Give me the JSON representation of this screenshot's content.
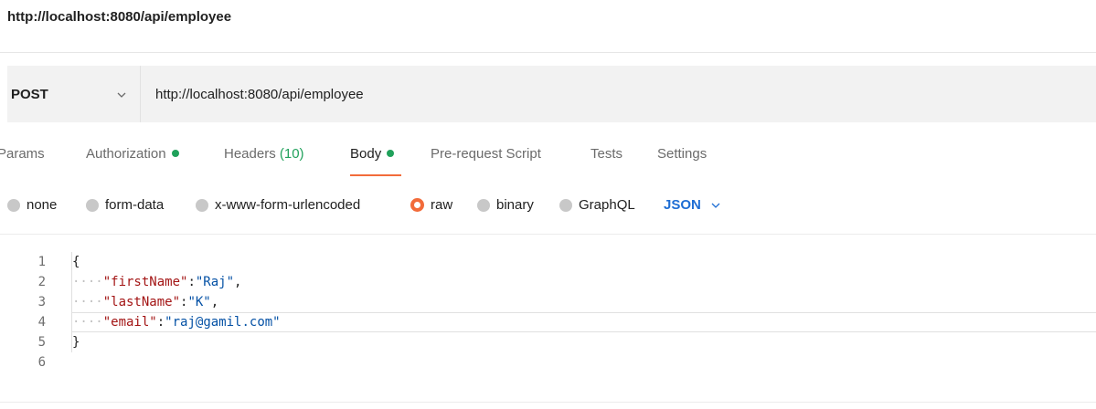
{
  "page_title": "http://localhost:8080/api/employee",
  "request": {
    "method": "POST",
    "url": "http://localhost:8080/api/employee"
  },
  "tabs": [
    {
      "label": "Params"
    },
    {
      "label": "Authorization"
    },
    {
      "label": "Headers",
      "count": "(10)"
    },
    {
      "label": "Body"
    },
    {
      "label": "Pre-request Script"
    },
    {
      "label": "Tests"
    },
    {
      "label": "Settings"
    }
  ],
  "active_tab": "Body",
  "body_options": {
    "none": "none",
    "form_data": "form-data",
    "urlencoded": "x-www-form-urlencoded",
    "raw": "raw",
    "binary": "binary",
    "graphql": "GraphQL",
    "selected": "raw",
    "format": "JSON"
  },
  "editor": {
    "line_numbers": [
      "1",
      "2",
      "3",
      "4",
      "5",
      "6"
    ],
    "lines": [
      {
        "open": "{"
      },
      {
        "indent": "····",
        "key": "\"firstName\"",
        "colon": ":",
        "value": "\"Raj\"",
        "comma": ","
      },
      {
        "indent": "····",
        "key": "\"lastName\"",
        "colon": ":",
        "value": "\"K\"",
        "comma": ","
      },
      {
        "indent": "····",
        "key": "\"email\"",
        "colon": ":",
        "value": "\"raj@gamil.com\""
      },
      {
        "close": "}"
      }
    ]
  },
  "colors": {
    "accent": "#f26b3a",
    "status_green": "#20a15b",
    "json_blue": "#1f6ed4",
    "key_red": "#a31515",
    "string_blue": "#0451a5"
  }
}
